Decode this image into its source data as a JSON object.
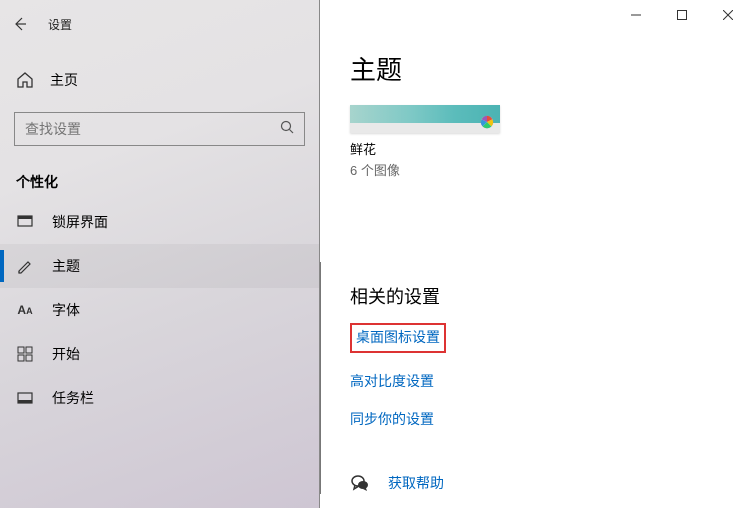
{
  "app": {
    "title": "设置"
  },
  "sidebar": {
    "home": "主页",
    "search_placeholder": "查找设置",
    "section": "个性化",
    "items": [
      {
        "label": "锁屏界面"
      },
      {
        "label": "主题"
      },
      {
        "label": "字体"
      },
      {
        "label": "开始"
      },
      {
        "label": "任务栏"
      }
    ]
  },
  "content": {
    "title": "主题",
    "theme": {
      "name": "鲜花",
      "subtitle": "6 个图像"
    },
    "related_title": "相关的设置",
    "links": [
      "桌面图标设置",
      "高对比度设置",
      "同步你的设置"
    ],
    "help": "获取帮助"
  }
}
